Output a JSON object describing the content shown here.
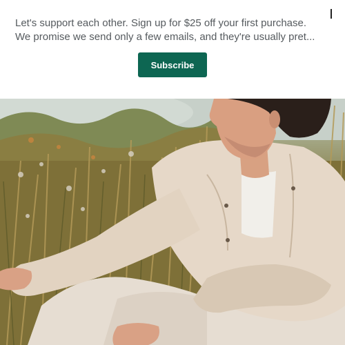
{
  "banner": {
    "line1": "Let's support each other. Sign up for $25 off your first purchase.",
    "line2": "We promise we send only a few emails, and they're usually pret...",
    "subscribe_label": "Subscribe",
    "close_icon": "close-icon",
    "button_color": "#0d6652"
  },
  "hero": {
    "icon": "hero-photo"
  }
}
